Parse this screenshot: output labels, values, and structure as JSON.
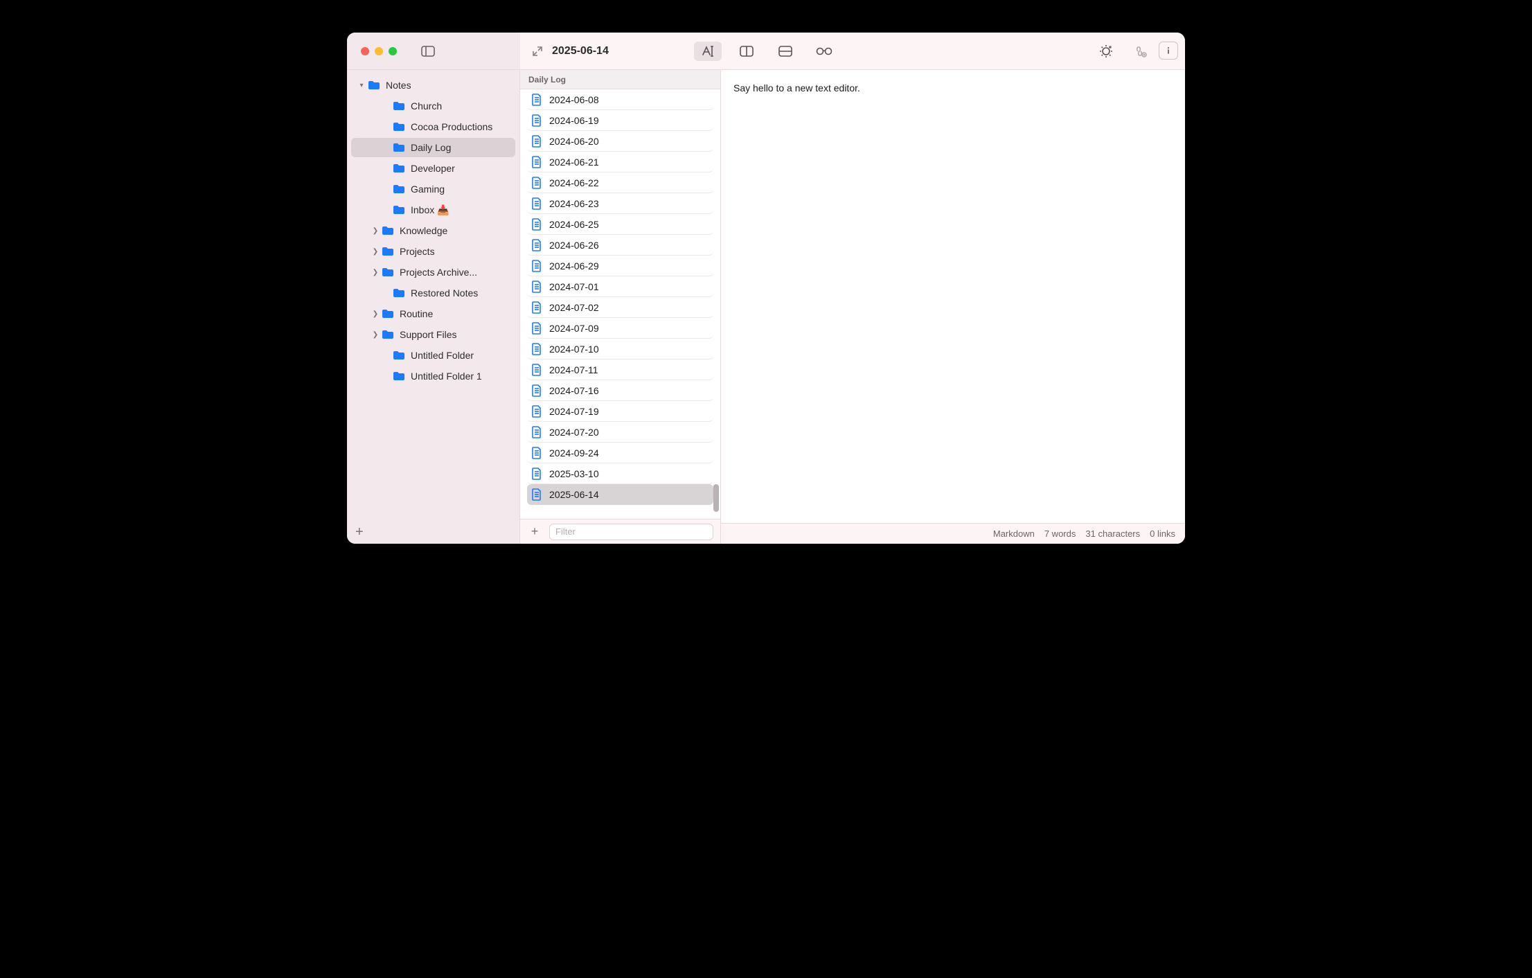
{
  "titlebar": {
    "document_title": "2025-06-14"
  },
  "sidebar": {
    "root": {
      "label": "Notes",
      "expanded": true
    },
    "items": [
      {
        "label": "Church",
        "hasChildren": false
      },
      {
        "label": "Cocoa Productions",
        "hasChildren": false
      },
      {
        "label": "Daily Log",
        "hasChildren": false,
        "selected": true
      },
      {
        "label": "Developer",
        "hasChildren": false
      },
      {
        "label": "Gaming",
        "hasChildren": false
      },
      {
        "label": "Inbox 📥",
        "hasChildren": false
      },
      {
        "label": "Knowledge",
        "hasChildren": true
      },
      {
        "label": "Projects",
        "hasChildren": true
      },
      {
        "label": "Projects Archive...",
        "hasChildren": true
      },
      {
        "label": "Restored Notes",
        "hasChildren": false
      },
      {
        "label": "Routine",
        "hasChildren": true
      },
      {
        "label": "Support Files",
        "hasChildren": true
      },
      {
        "label": "Untitled Folder",
        "hasChildren": false
      },
      {
        "label": "Untitled Folder 1",
        "hasChildren": false
      }
    ]
  },
  "filelist": {
    "header": "Daily Log",
    "filter_placeholder": "Filter",
    "items": [
      {
        "label": "2024-06-08"
      },
      {
        "label": "2024-06-19"
      },
      {
        "label": "2024-06-20"
      },
      {
        "label": "2024-06-21"
      },
      {
        "label": "2024-06-22"
      },
      {
        "label": "2024-06-23"
      },
      {
        "label": "2024-06-25"
      },
      {
        "label": "2024-06-26"
      },
      {
        "label": "2024-06-29"
      },
      {
        "label": "2024-07-01"
      },
      {
        "label": "2024-07-02"
      },
      {
        "label": "2024-07-09"
      },
      {
        "label": "2024-07-10"
      },
      {
        "label": "2024-07-11"
      },
      {
        "label": "2024-07-16"
      },
      {
        "label": "2024-07-19"
      },
      {
        "label": "2024-07-20"
      },
      {
        "label": "2024-09-24"
      },
      {
        "label": "2025-03-10"
      },
      {
        "label": "2025-06-14",
        "selected": true
      }
    ]
  },
  "editor": {
    "content": "Say hello to a new text editor."
  },
  "statusbar": {
    "format": "Markdown",
    "words": "7 words",
    "characters": "31 characters",
    "links": "0 links"
  }
}
